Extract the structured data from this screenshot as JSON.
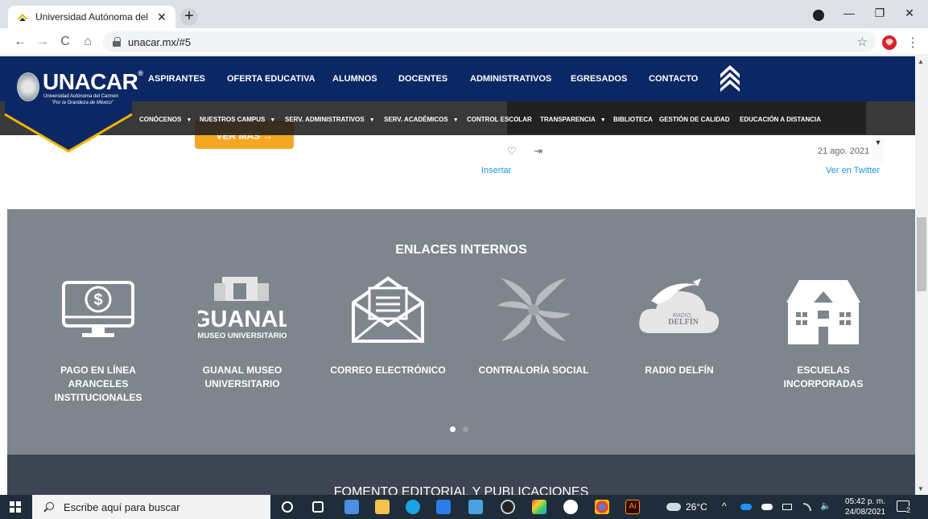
{
  "browser": {
    "tab_title": "Universidad Autónoma del Carme",
    "tab_close": "✕",
    "new_tab": "+",
    "url": "unacar.mx/#5",
    "back": "←",
    "forward": "→",
    "reload": "C",
    "home": "⌂",
    "star": "☆",
    "menu": "⋮",
    "minimize": "—",
    "maximize": "❐",
    "close": "✕"
  },
  "header": {
    "logo_text": "UNACAR",
    "logo_reg": "®",
    "logo_sub1": "Universidad Autónoma del Carmen",
    "logo_sub2": "\"Por la Grandeza de México\"",
    "nav_main": [
      "ASPIRANTES",
      "OFERTA EDUCATIVA",
      "ALUMNOS",
      "DOCENTES",
      "ADMINISTRATIVOS",
      "EGRESADOS",
      "CONTACTO"
    ],
    "nav_sub": [
      {
        "label": "CONÓCENOS",
        "caret": "▼"
      },
      {
        "label": "NUESTROS CAMPUS",
        "caret": "▼"
      },
      {
        "label": "SERV. ADMINISTRATIVOS",
        "caret": "▼"
      },
      {
        "label": "SERV. ACADÉMICOS",
        "caret": "▼"
      },
      {
        "label": "CONTROL ESCOLAR",
        "caret": ""
      },
      {
        "label": "TRANSPARENCIA",
        "caret": "▼"
      },
      {
        "label": "BIBLIOTECA",
        "caret": ""
      },
      {
        "label": "GESTIÓN DE CALIDAD",
        "caret": ""
      },
      {
        "label": "EDUCACIÓN A DISTANCIA",
        "caret": ""
      }
    ]
  },
  "content": {
    "ver_mas": "VER MÁS →",
    "tweet_like": "♡",
    "tweet_share": "⇥",
    "tweet_date": "21 ago. 2021",
    "tweet_embed": "Insertar",
    "tweet_view": "Ver en Twitter",
    "tweet_scroll": "▼"
  },
  "enlaces": {
    "title": "ENLACES INTERNOS",
    "items": [
      {
        "label": "PAGO EN LÍNEA ARANCELES INSTITUCIONALES",
        "icon": "payment-monitor-icon"
      },
      {
        "label": "GUANAL MUSEO UNIVERSITARIO",
        "icon": "guanal-museum-icon"
      },
      {
        "label": "CORREO ELECTRÓNICO",
        "icon": "envelope-icon"
      },
      {
        "label": "CONTRALORÍA SOCIAL",
        "icon": "contraloria-icon"
      },
      {
        "label": "RADIO DELFÍN",
        "icon": "radio-dolphin-icon"
      },
      {
        "label": "ESCUELAS INCORPORADAS",
        "icon": "school-building-icon"
      }
    ],
    "guanal_logo_text": "GUANAL",
    "guanal_logo_sub": "MUSEO UNIVERSITARIO",
    "radio_logo_text": "DELFÍN",
    "radio_logo_sub": "RADIO"
  },
  "fomento_title": "FOMENTO EDITORIAL Y PUBLICACIONES",
  "taskbar": {
    "search_placeholder": "Escribe aquí para buscar",
    "weather": "26°C",
    "time": "05:42 p. m.",
    "date": "24/08/2021",
    "notifications": "2",
    "tray_up": "^",
    "volume": "🔈"
  },
  "colors": {
    "header_blue": "#0b2764",
    "section_gray": "#7f858d",
    "accent_orange": "#f5a623",
    "link_blue": "#1b95e0"
  }
}
